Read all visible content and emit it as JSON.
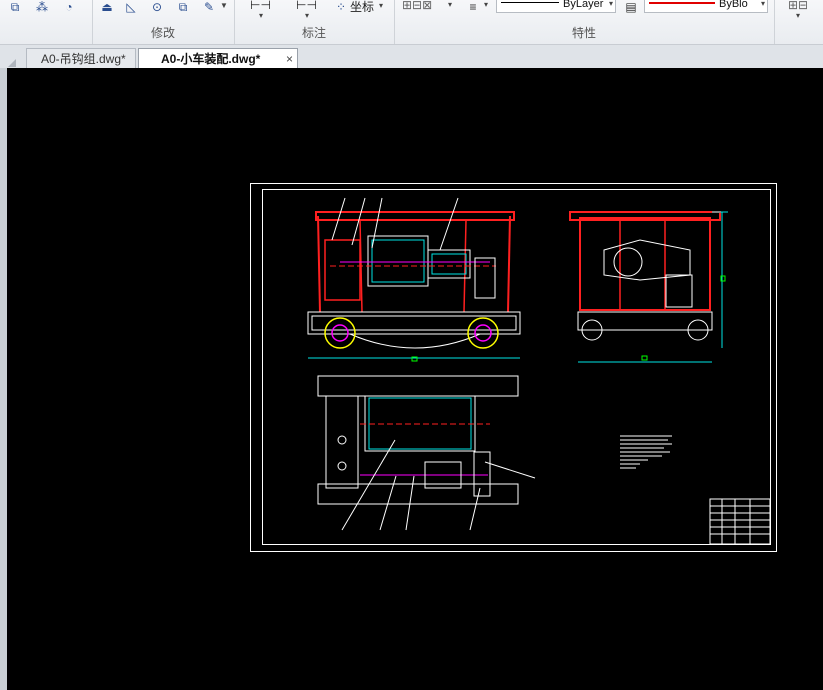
{
  "ribbon": {
    "panels": [
      {
        "name": "modify",
        "title": "修改"
      },
      {
        "name": "annotate",
        "title": "标注"
      },
      {
        "name": "properties",
        "title": "特性"
      }
    ],
    "coordinate_label": "坐标",
    "bylayer_label": "ByLayer",
    "byblock_label": "ByBlo"
  },
  "tabs": [
    {
      "label": "A0-吊钩组.dwg*",
      "active": false
    },
    {
      "label": "A0-小车装配.dwg*",
      "active": true
    }
  ],
  "tab_close_glyph": "×",
  "colors": {
    "canvas": "#000000",
    "frame": "#ffffff",
    "red": "#ff2020",
    "cyan": "#00e5e5",
    "magenta": "#ff00ff",
    "green": "#00ff00"
  }
}
